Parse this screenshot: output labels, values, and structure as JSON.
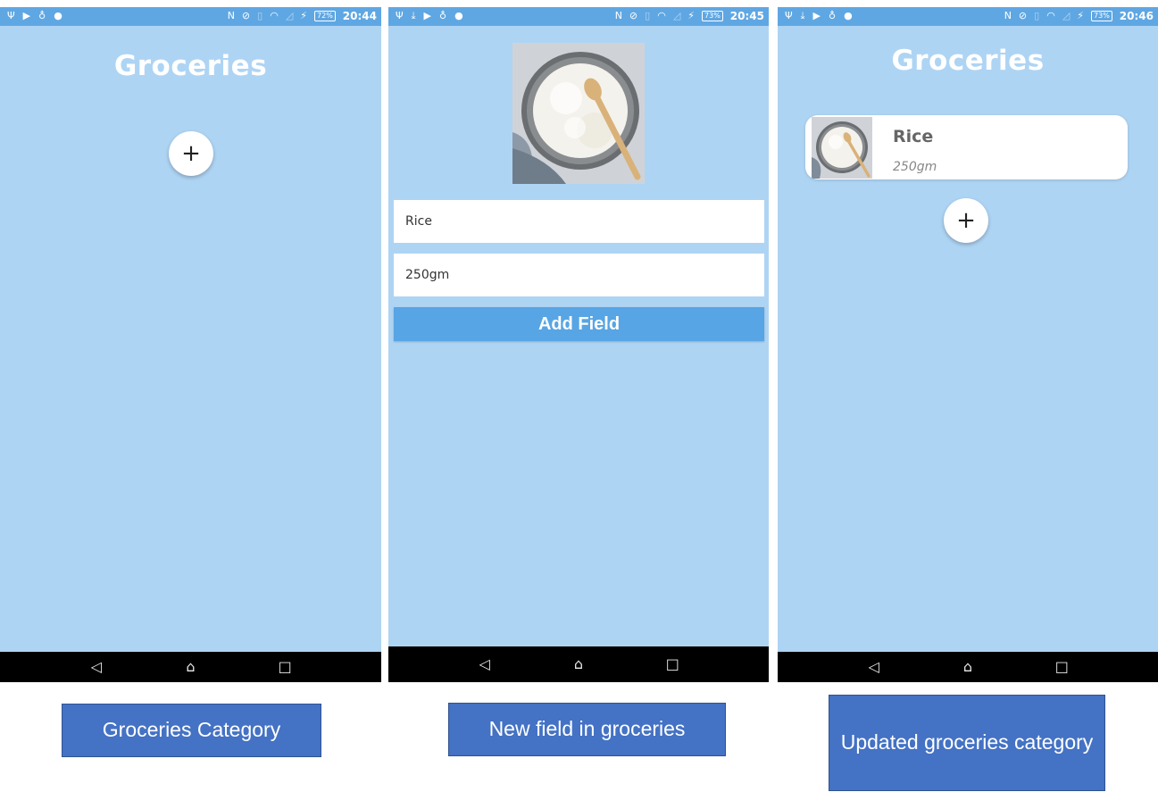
{
  "screens": [
    {
      "statusbar": {
        "left_icons": [
          "usb-icon",
          "play-store-icon",
          "bulb-icon",
          "location-icon"
        ],
        "battery": "72%",
        "time": "20:44"
      },
      "title": "Groceries",
      "fab_label": "+"
    },
    {
      "statusbar": {
        "left_icons": [
          "usb-icon",
          "download-icon",
          "play-store-icon",
          "bulb-icon",
          "location-icon"
        ],
        "battery": "73%",
        "time": "20:45"
      },
      "name_value": "Rice",
      "quantity_value": "250gm",
      "add_button_label": "Add Field"
    },
    {
      "statusbar": {
        "left_icons": [
          "usb-icon",
          "download-icon",
          "play-store-icon",
          "bulb-icon",
          "location-icon"
        ],
        "battery": "73%",
        "time": "20:46"
      },
      "title": "Groceries",
      "items": [
        {
          "name": "Rice",
          "quantity": "250gm"
        }
      ],
      "fab_label": "+"
    }
  ],
  "nav": {
    "back": "◁",
    "home": "⌂",
    "recents": "□"
  },
  "captions": [
    "Groceries Category",
    "New field in groceries",
    "Updated groceries category"
  ],
  "colors": {
    "screen_bg": "#aed4f4",
    "statusbar": "#5fa7e3",
    "accent_button": "#57a5e4",
    "caption_bg": "#4472c4"
  }
}
